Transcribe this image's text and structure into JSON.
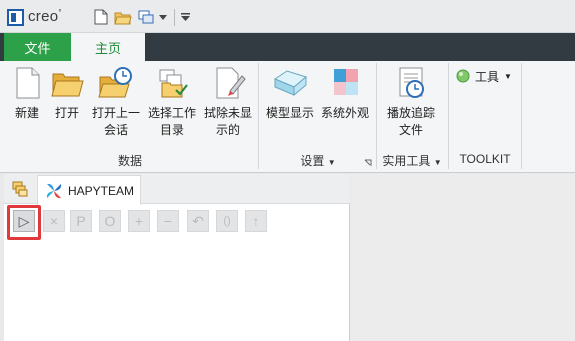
{
  "app": {
    "brand": "creo",
    "brand_mark": "°"
  },
  "tabs": {
    "file": "文件",
    "home": "主页"
  },
  "ribbon": {
    "buttons": {
      "new": {
        "line1": "新建",
        "line2": ""
      },
      "open": {
        "line1": "打开",
        "line2": ""
      },
      "open_last": {
        "line1": "打开上一",
        "line2": "会话"
      },
      "select_workdir": {
        "line1": "选择工作",
        "line2": "目录"
      },
      "erase_undisplayed": {
        "line1": "拭除未显",
        "line2": "示的"
      },
      "model_display": {
        "line1": "模型显示",
        "line2": ""
      },
      "system_appearance": {
        "line1": "系统外观",
        "line2": ""
      },
      "play_trail": {
        "line1": "播放追踪",
        "line2": "文件"
      },
      "tools": {
        "label": "工具"
      }
    },
    "groups": {
      "data": "数据",
      "settings": "设置",
      "utilities": "实用工具",
      "toolkit": "TOOLKIT"
    }
  },
  "navigator": {
    "tab_label": "HAPYTEAM",
    "tools": [
      "▷",
      "×",
      "P",
      "O",
      "+",
      "−",
      "↶",
      "()",
      "↑"
    ]
  },
  "colors": {
    "file_tab": "#2da04a",
    "tab_bar": "#323a42",
    "highlight": "#e0393c"
  }
}
